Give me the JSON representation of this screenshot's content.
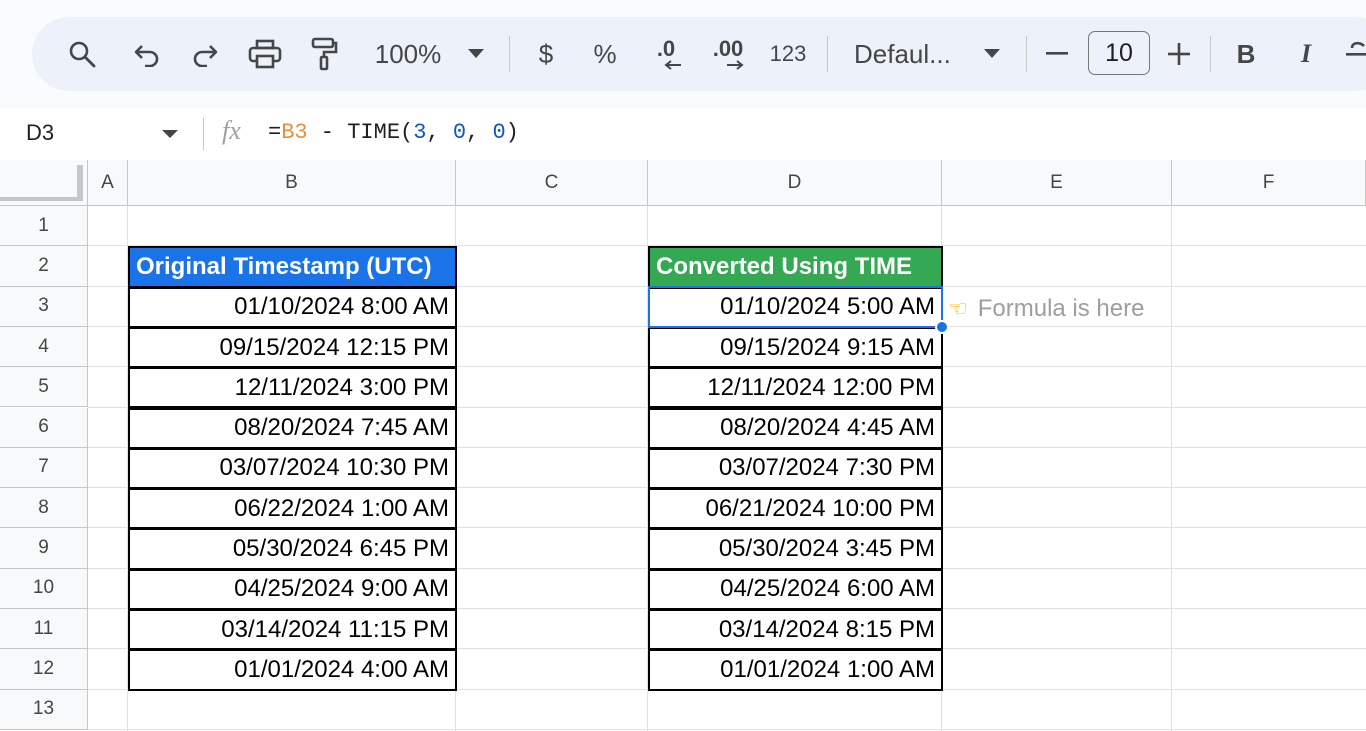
{
  "toolbar": {
    "zoom": "100%",
    "currency": "$",
    "percent": "%",
    "dec_decrease": ".0",
    "dec_increase": ".00",
    "number_format": "123",
    "font": "Defaul...",
    "font_size": "10",
    "bold": "B",
    "italic": "I",
    "icons": [
      "search-icon",
      "undo-icon",
      "redo-icon",
      "print-icon",
      "paint-format-icon",
      "zoom-dropdown-icon",
      "font-dropdown-icon",
      "minus-icon",
      "plus-icon",
      "strikethrough-icon"
    ]
  },
  "formula_bar": {
    "cell_ref": "D3",
    "fx": "fx",
    "formula_eq": "=",
    "formula_ref": "B3",
    "formula_mid": " - TIME(",
    "formula_n1": "3",
    "formula_c1": ", ",
    "formula_n2": "0",
    "formula_c2": ", ",
    "formula_n3": "0",
    "formula_end": ")"
  },
  "columns": [
    "A",
    "B",
    "C",
    "D",
    "E",
    "F"
  ],
  "rows": [
    "1",
    "2",
    "3",
    "4",
    "5",
    "6",
    "7",
    "8",
    "9",
    "10",
    "11",
    "12",
    "13"
  ],
  "table_original": {
    "header": "Original Timestamp (UTC)",
    "header_color": "#1a73e8",
    "values": [
      "01/10/2024 8:00 AM",
      "09/15/2024 12:15 PM",
      "12/11/2024 3:00 PM",
      "08/20/2024 7:45 AM",
      "03/07/2024 10:30 PM",
      "06/22/2024 1:00 AM",
      "05/30/2024 6:45 PM",
      "04/25/2024 9:00 AM",
      "03/14/2024 11:15 PM",
      "01/01/2024 4:00 AM"
    ]
  },
  "table_converted": {
    "header": "Converted Using TIME",
    "header_color": "#34a853",
    "values": [
      "01/10/2024 5:00 AM",
      "09/15/2024 9:15 AM",
      "12/11/2024 12:00 PM",
      "08/20/2024 4:45 AM",
      "03/07/2024 7:30 PM",
      "06/21/2024 10:00 PM",
      "05/30/2024 3:45 PM",
      "04/25/2024 6:00 AM",
      "03/14/2024 8:15 PM",
      "01/01/2024 1:00 AM"
    ]
  },
  "note": {
    "icon": "pointing-hand-icon",
    "text": "Formula is here"
  },
  "selection_color": "#1a73e8"
}
